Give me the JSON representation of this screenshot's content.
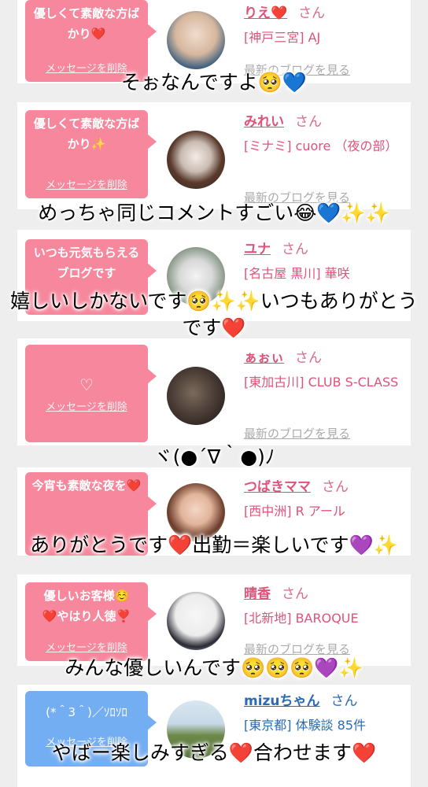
{
  "colors": {
    "pink": "#f6879c",
    "pink_text": "#e0527a",
    "blue": "#74aef2",
    "blue_text": "#2a6ab5",
    "blog_gray": "#aaaaaa"
  },
  "delete_label": "メッセージを削除",
  "blog_label": "最新のブログを見る",
  "san_label": "さん",
  "cards": [
    {
      "message": "優しくて素敵な方ばかり❤️",
      "name": "りえ❤️",
      "store": "[神戸三宮] AJ"
    },
    {
      "message": "優しくて素敵な方ばかり✨",
      "name": "みれい",
      "store": "[ミナミ] cuore （夜の部）"
    },
    {
      "message": "いつも元気もらえるブログです",
      "name": "ユナ",
      "store": "[名古屋 黒川] 華咲"
    },
    {
      "message": "♡",
      "name": "ぁぉぃ",
      "store": "[東加古川] CLUB S-CLASS"
    },
    {
      "message": "今宵も素敵な夜を❤️",
      "name": "つばきママ",
      "store": "[西中洲] R アール"
    },
    {
      "message": "優しいお客様☺️❤️やはり人徳❣️",
      "name": "晴香",
      "store": "[北新地] BAROQUE"
    },
    {
      "message": "(*＾3＾)／ｿﾛｿﾛ",
      "name": "mizuちゃん",
      "store": "[東京都] 体験談 85件"
    }
  ],
  "captions": [
    "そぉなんですよ🥺💙",
    "めっちゃ同じコメントすごい😂💙✨✨",
    "嬉しいしかないです🥺✨✨いつもありがとうです❤️",
    "ヾ(●´∇｀●)ﾉ",
    "ありがとうです❤️出勤＝楽しいです💜✨",
    "みんな優しいんです🥺🥺🥺💜✨",
    "やばー楽しみすぎる❤️合わせます❤️"
  ]
}
